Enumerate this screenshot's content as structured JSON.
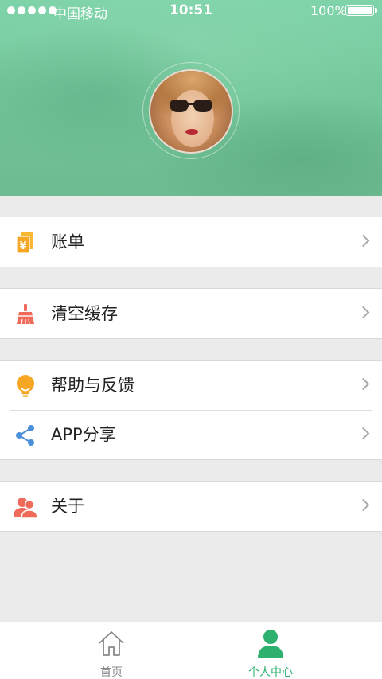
{
  "status_bar": {
    "carrier": "中国移动",
    "time": "10:51",
    "battery": "100%"
  },
  "colors": {
    "header_green": "#77c99d",
    "accent_green": "#2eb06f",
    "bill_icon": "#f5a623",
    "clear_icon": "#f06a5a",
    "help_icon": "#f5a623",
    "share_icon": "#4a90d9",
    "about_icon": "#f06a5a"
  },
  "profile": {
    "avatar_icon": "user-avatar-photo"
  },
  "menu": {
    "bill": {
      "label": "账单",
      "icon": "bill-yen-icon"
    },
    "clear_cache": {
      "label": "清空缓存",
      "icon": "broom-icon"
    },
    "help_feedback": {
      "label": "帮助与反馈",
      "icon": "lightbulb-icon"
    },
    "app_share": {
      "label": "APP分享",
      "icon": "share-icon"
    },
    "about": {
      "label": "关于",
      "icon": "people-icon"
    }
  },
  "tabbar": {
    "home": {
      "label": "首页",
      "icon": "home-icon"
    },
    "me": {
      "label": "个人中心",
      "icon": "person-icon",
      "active": true
    }
  }
}
